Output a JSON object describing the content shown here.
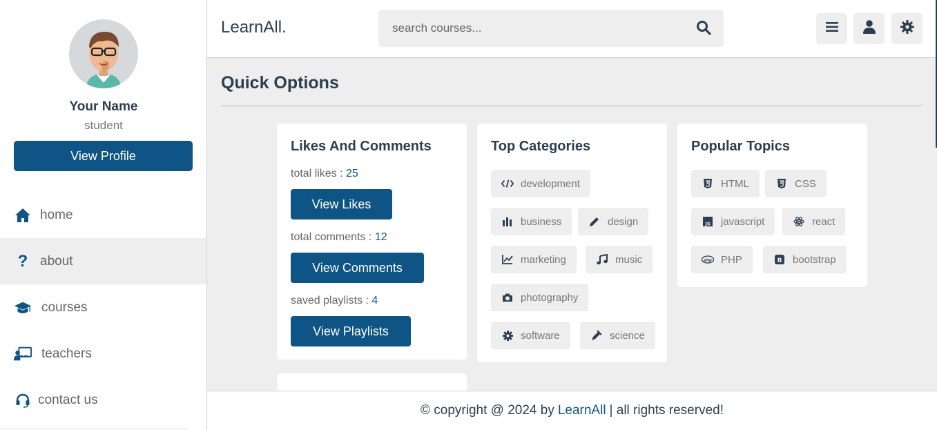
{
  "profile": {
    "name": "Your Name",
    "role": "student",
    "button": "View Profile"
  },
  "nav": [
    {
      "label": "home",
      "icon": "home-icon"
    },
    {
      "label": "about",
      "icon": "question-icon"
    },
    {
      "label": "courses",
      "icon": "graduation-cap-icon"
    },
    {
      "label": "teachers",
      "icon": "teacher-icon"
    },
    {
      "label": "contact us",
      "icon": "headset-icon"
    }
  ],
  "header": {
    "logo": "LearnAll.",
    "search_placeholder": "search courses..."
  },
  "main": {
    "title": "Quick Options"
  },
  "likes_card": {
    "title": "Likes And Comments",
    "likes_label": "total likes : ",
    "likes_value": "25",
    "likes_button": "View Likes",
    "comments_label": "total comments : ",
    "comments_value": "12",
    "comments_button": "View Comments",
    "playlists_label": "saved playlists : ",
    "playlists_value": "4",
    "playlists_button": "View Playlists"
  },
  "categories_card": {
    "title": "Top Categories",
    "items": [
      {
        "label": "development",
        "icon": "code-icon"
      },
      {
        "label": "business",
        "icon": "bar-chart-icon"
      },
      {
        "label": "design",
        "icon": "pen-icon"
      },
      {
        "label": "marketing",
        "icon": "line-chart-icon"
      },
      {
        "label": "music",
        "icon": "music-icon"
      },
      {
        "label": "photography",
        "icon": "camera-icon"
      },
      {
        "label": "software",
        "icon": "cog-icon"
      },
      {
        "label": "science",
        "icon": "vial-icon"
      }
    ]
  },
  "topics_card": {
    "title": "Popular Topics",
    "items": [
      {
        "label": "HTML",
        "icon": "html5-icon"
      },
      {
        "label": "CSS",
        "icon": "css3-icon"
      },
      {
        "label": "javascript",
        "icon": "js-icon"
      },
      {
        "label": "react",
        "icon": "react-icon"
      },
      {
        "label": "PHP",
        "icon": "php-icon"
      },
      {
        "label": "bootstrap",
        "icon": "bootstrap-icon"
      }
    ]
  },
  "footer": {
    "prefix": "© copyright @ 2024 by",
    "brand": "LearnAll",
    "suffix": "| all rights reserved!"
  },
  "colors": {
    "accent": "#0e5484",
    "text": "#2c3e50",
    "background": "#eeeeee"
  }
}
